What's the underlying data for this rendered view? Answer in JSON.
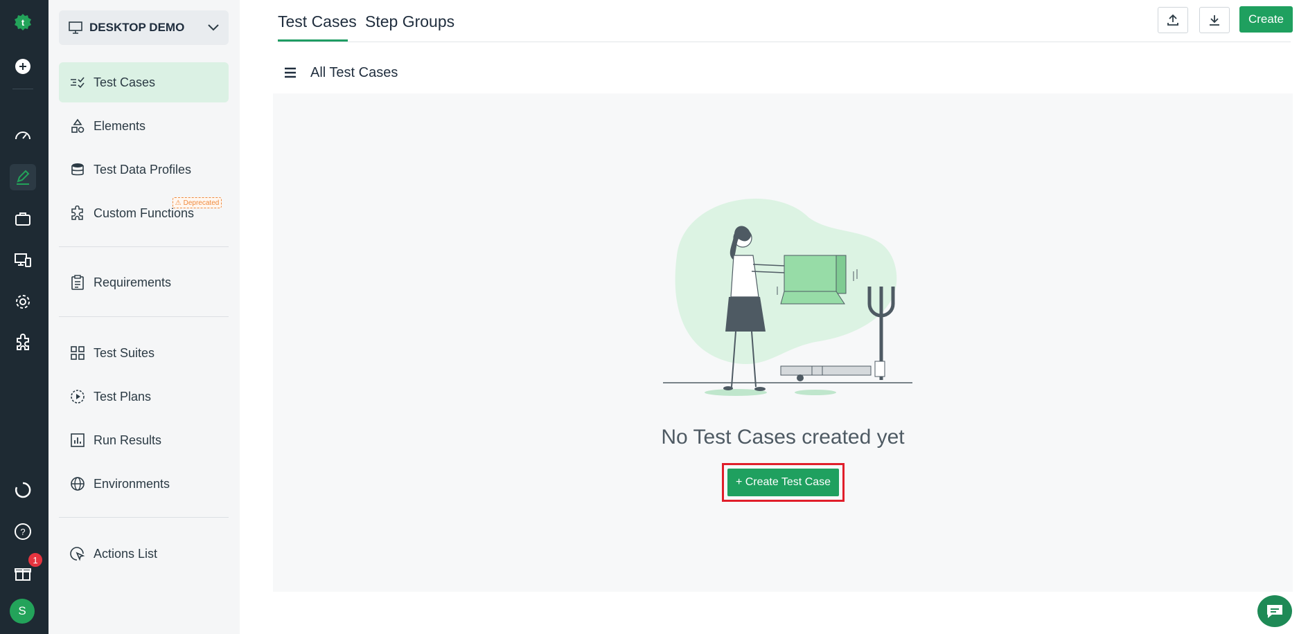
{
  "rail": {
    "items": [
      "logo-icon",
      "add-icon",
      "dashboard-icon",
      "edit-icon",
      "briefcase-icon",
      "devices-icon",
      "settings-icon",
      "addon-icon",
      "refresh-icon",
      "help-icon",
      "gift-icon"
    ],
    "notification_count": "1",
    "avatar_initial": "S"
  },
  "sidebar": {
    "workspace": "DESKTOP DEMO",
    "items": [
      {
        "label": "Test Cases",
        "icon": "test-cases-icon",
        "active": true
      },
      {
        "label": "Elements",
        "icon": "shapes-icon"
      },
      {
        "label": "Test Data Profiles",
        "icon": "database-icon"
      },
      {
        "label": "Custom Functions",
        "icon": "puzzle-icon",
        "badge": "Deprecated"
      },
      {
        "label": "Requirements",
        "icon": "clipboard-icon"
      },
      {
        "label": "Test Suites",
        "icon": "grid-icon"
      },
      {
        "label": "Test Plans",
        "icon": "play-circle-icon"
      },
      {
        "label": "Run Results",
        "icon": "chart-icon"
      },
      {
        "label": "Environments",
        "icon": "globe-icon"
      },
      {
        "label": "Actions List",
        "icon": "click-icon"
      }
    ]
  },
  "header": {
    "tabs": [
      "Test Cases",
      "Step Groups"
    ],
    "create_label": "Create"
  },
  "list": {
    "title": "All Test Cases"
  },
  "empty_state": {
    "message": "No Test Cases created yet",
    "button_label": "+ Create Test Case"
  },
  "colors": {
    "accent": "#1fa05f",
    "rail_bg": "#1e2a33",
    "active_item_bg": "#dbf1e4",
    "highlight": "#e01e2b"
  }
}
